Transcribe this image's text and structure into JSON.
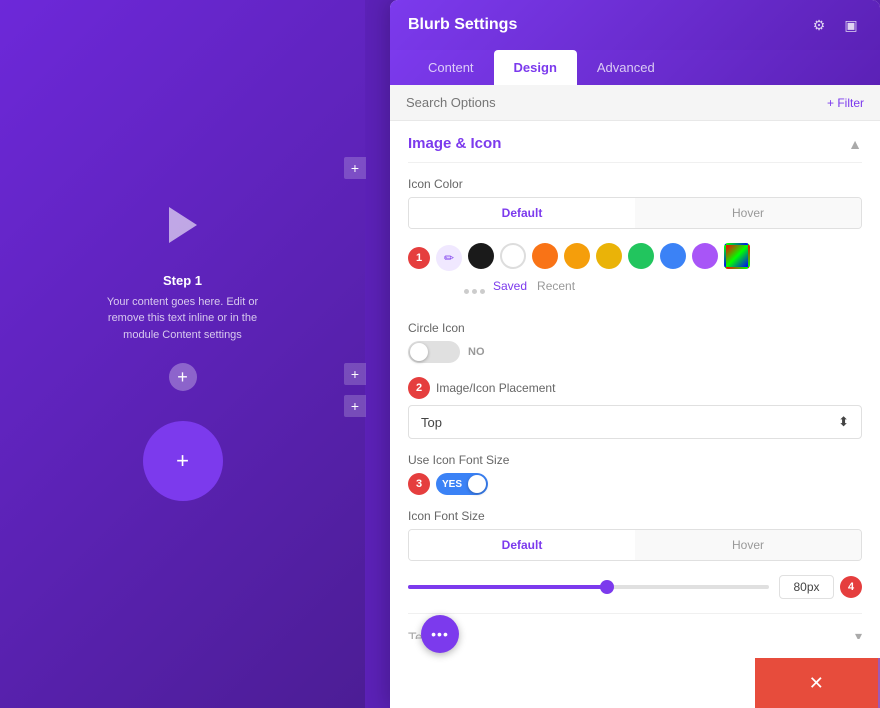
{
  "canvas": {
    "step_label": "Step 1",
    "step_text": "Your content goes here. Edit or remove this text inline or in the module Content settings"
  },
  "panel": {
    "title": "Blurb Settings",
    "tabs": [
      "Content",
      "Design",
      "Advanced"
    ],
    "active_tab": "Design",
    "search_placeholder": "Search Options",
    "filter_label": "+ Filter"
  },
  "image_icon_section": {
    "title": "Image & Icon",
    "icon_color_label": "Icon Color",
    "default_tab": "Default",
    "hover_tab": "Hover",
    "colors": [
      {
        "name": "black",
        "hex": "#1a1a1a"
      },
      {
        "name": "white",
        "hex": "#ffffff"
      },
      {
        "name": "orange",
        "hex": "#f97316"
      },
      {
        "name": "amber",
        "hex": "#f59e0b"
      },
      {
        "name": "yellow",
        "hex": "#eab308"
      },
      {
        "name": "green",
        "hex": "#22c55e"
      },
      {
        "name": "blue",
        "hex": "#3b82f6"
      },
      {
        "name": "purple",
        "hex": "#a855f7"
      }
    ],
    "saved_label": "Saved",
    "recent_label": "Recent",
    "circle_icon_label": "Circle Icon",
    "circle_icon_value": "NO",
    "placement_label": "Image/Icon Placement",
    "placement_value": "Top",
    "use_font_size_label": "Use Icon Font Size",
    "use_font_size_value": "YES",
    "icon_font_size_label": "Icon Font Size",
    "font_size_default_tab": "Default",
    "font_size_hover_tab": "Hover",
    "slider_value": "80px",
    "slider_percent": 55
  },
  "text_section": {
    "title": "Text"
  },
  "toolbar": {
    "cancel_icon": "✕",
    "reset_icon": "↺",
    "redo_icon": "↻",
    "confirm_icon": "✓"
  },
  "badges": {
    "b1": "1",
    "b2": "2",
    "b3": "3",
    "b4": "4"
  }
}
